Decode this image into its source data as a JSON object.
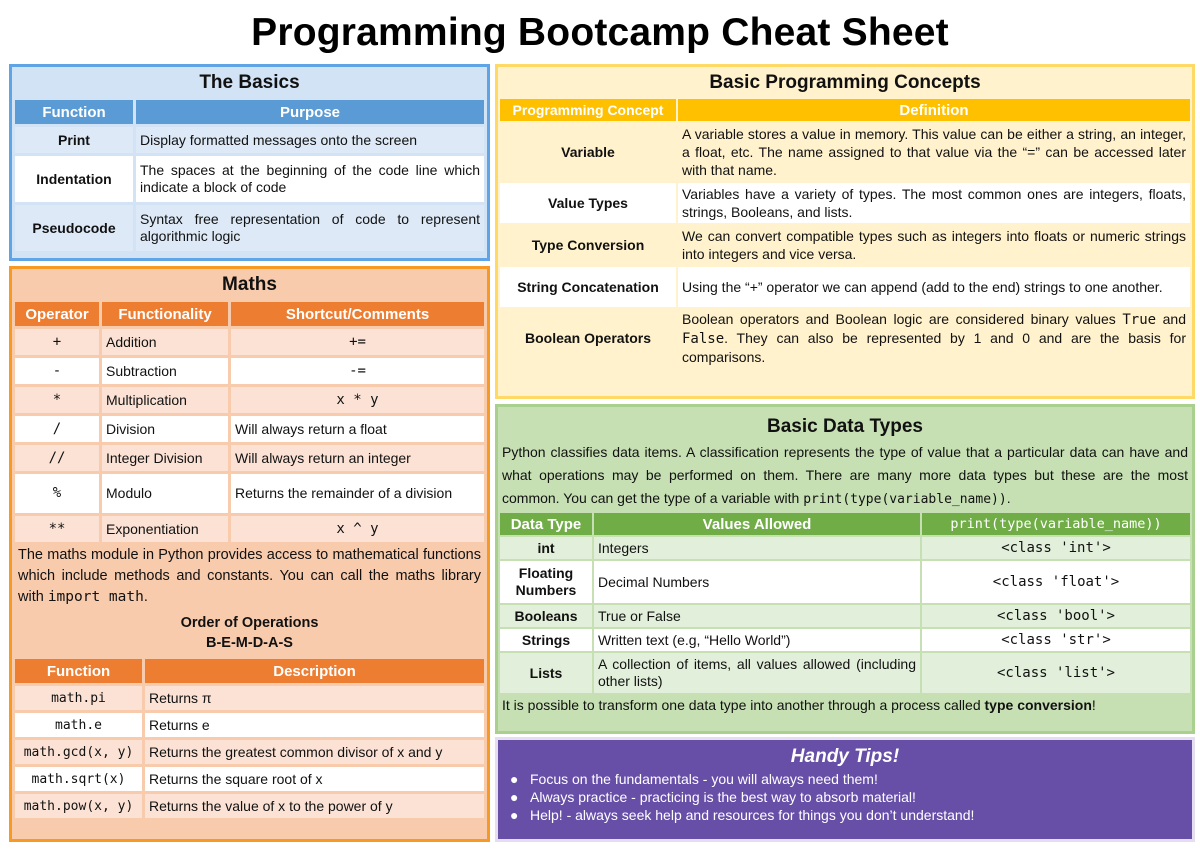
{
  "title": "Programming Bootcamp Cheat Sheet",
  "basics": {
    "title": "The Basics",
    "headers": [
      "Function",
      "Purpose"
    ],
    "rows": [
      {
        "function": "Print",
        "purpose": "Display formatted messages onto the screen"
      },
      {
        "function": "Indentation",
        "purpose": "The spaces at the beginning of the code line which indicate a block of code"
      },
      {
        "function": "Pseudocode",
        "purpose": "Syntax free representation of code to represent algorithmic logic"
      }
    ]
  },
  "maths": {
    "title": "Maths",
    "operator_headers": [
      "Operator",
      "Functionality",
      "Shortcut/Comments"
    ],
    "operators": [
      {
        "op": "+",
        "name": "Addition",
        "comment": "+="
      },
      {
        "op": "-",
        "name": "Subtraction",
        "comment": "-="
      },
      {
        "op": "*",
        "name": "Multiplication",
        "comment": "x * y"
      },
      {
        "op": "/",
        "name": "Division",
        "comment": "Will always return a float"
      },
      {
        "op": "//",
        "name": "Integer Division",
        "comment": "Will always return an integer"
      },
      {
        "op": "%",
        "name": "Modulo",
        "comment": "Returns the remainder of a division"
      },
      {
        "op": "**",
        "name": "Exponentiation",
        "comment": "x ^ y"
      }
    ],
    "module_text_1": "The maths module in Python provides access to mathematical functions which include methods and constants. You can call the maths library with ",
    "module_code": "import math",
    "module_text_2": ".",
    "order_title": "Order of Operations",
    "order_value": "B-E-M-D-A-S",
    "function_headers": [
      "Function",
      "Description"
    ],
    "functions": [
      {
        "fn": "math.pi",
        "desc": "Returns π"
      },
      {
        "fn": "math.e",
        "desc": "Returns e"
      },
      {
        "fn": "math.gcd(x, y)",
        "desc": "Returns the greatest common divisor of x and y"
      },
      {
        "fn": "math.sqrt(x)",
        "desc": "Returns the square root of x"
      },
      {
        "fn": "math.pow(x, y)",
        "desc": "Returns the value of x to the power of y"
      }
    ]
  },
  "concepts": {
    "title": "Basic Programming Concepts",
    "headers": [
      "Programming Concept",
      "Definition"
    ],
    "rows": [
      {
        "concept": "Variable",
        "definition": "A variable stores a value in memory. This value can be either a string, an integer, a float, etc. The name assigned to that value via the “=” can be accessed later with that name."
      },
      {
        "concept": "Value Types",
        "definition": "Variables have a variety of types. The most common ones are integers, floats, strings, Booleans, and lists."
      },
      {
        "concept": "Type Conversion",
        "definition": "We can convert compatible types such as integers into floats or numeric strings into integers and vice versa."
      },
      {
        "concept": "String Concatenation",
        "definition": "Using the “+” operator we can append (add to the end) strings to one another."
      },
      {
        "concept": "Boolean Operators",
        "definition_1": "Boolean operators and Boolean logic are considered binary values ",
        "code_true": "True",
        "definition_2": " and ",
        "code_false": "False",
        "definition_3": ". They can also be represented by 1 and 0 and are the basis for comparisons."
      }
    ]
  },
  "datatypes": {
    "title": "Basic Data Types",
    "intro_1": "Python classifies data items. A classification represents the type of value that a particular data can have and what operations may be performed on them. There are many more data types but these are the most common. You can get the type of a variable with ",
    "intro_code": "print(type(variable_name))",
    "intro_2": ".",
    "headers": [
      "Data Type",
      "Values Allowed",
      "print(type(variable_name))"
    ],
    "rows": [
      {
        "type": "int",
        "values": "Integers",
        "output": "<class 'int'>"
      },
      {
        "type": "Floating Numbers",
        "values": "Decimal Numbers",
        "output": "<class 'float'>"
      },
      {
        "type": "Booleans",
        "values": "True or False",
        "output": "<class 'bool'>"
      },
      {
        "type": "Strings",
        "values": "Written text (e.g, “Hello World”)",
        "output": "<class 'str'>"
      },
      {
        "type": "Lists",
        "values": "A collection of items, all values allowed (including other lists)",
        "output": "<class 'list'>"
      }
    ],
    "footer_1": "It is possible to transform one data type into another through a process called ",
    "footer_bold": "type conversion",
    "footer_2": "!"
  },
  "tips": {
    "title": "Handy Tips!",
    "bullet_icon": "●",
    "items": [
      "Focus on the fundamentals - you will always need them!",
      "Always practice - practicing is the best way to absorb material!",
      "Help! - always seek help and resources for things you don’t understand!"
    ]
  },
  "colors": {
    "basics_accent": "#5b9bd5",
    "maths_accent": "#ed7d31",
    "concepts_accent": "#ffc000",
    "datatypes_accent": "#70ad47",
    "tips_background": "#674ea7"
  }
}
